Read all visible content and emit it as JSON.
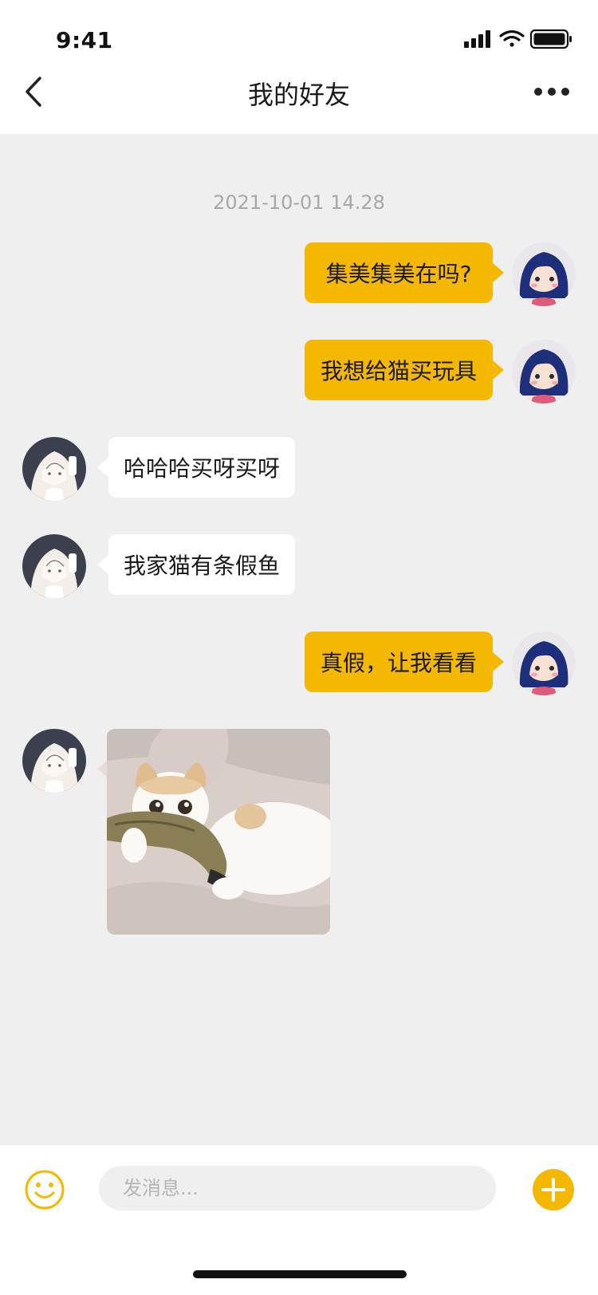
{
  "status_bar": {
    "time": "9:41"
  },
  "header": {
    "title": "我的好友"
  },
  "chat": {
    "timestamp": "2021-10-01 14.28",
    "messages": [
      {
        "side": "me",
        "text": "集美集美在吗?"
      },
      {
        "side": "me",
        "text": "我想给猫买玩具"
      },
      {
        "side": "them",
        "text": "哈哈哈买呀买呀"
      },
      {
        "side": "them",
        "text": "我家猫有条假鱼"
      },
      {
        "side": "me",
        "text": "真假，让我看看"
      },
      {
        "side": "them",
        "type": "image",
        "image": "cat-with-toy-fish-photo"
      }
    ]
  },
  "composer": {
    "placeholder": "发消息..."
  },
  "colors": {
    "accent": "#f5b800",
    "background": "#efefef",
    "bubble_other": "#ffffff"
  }
}
